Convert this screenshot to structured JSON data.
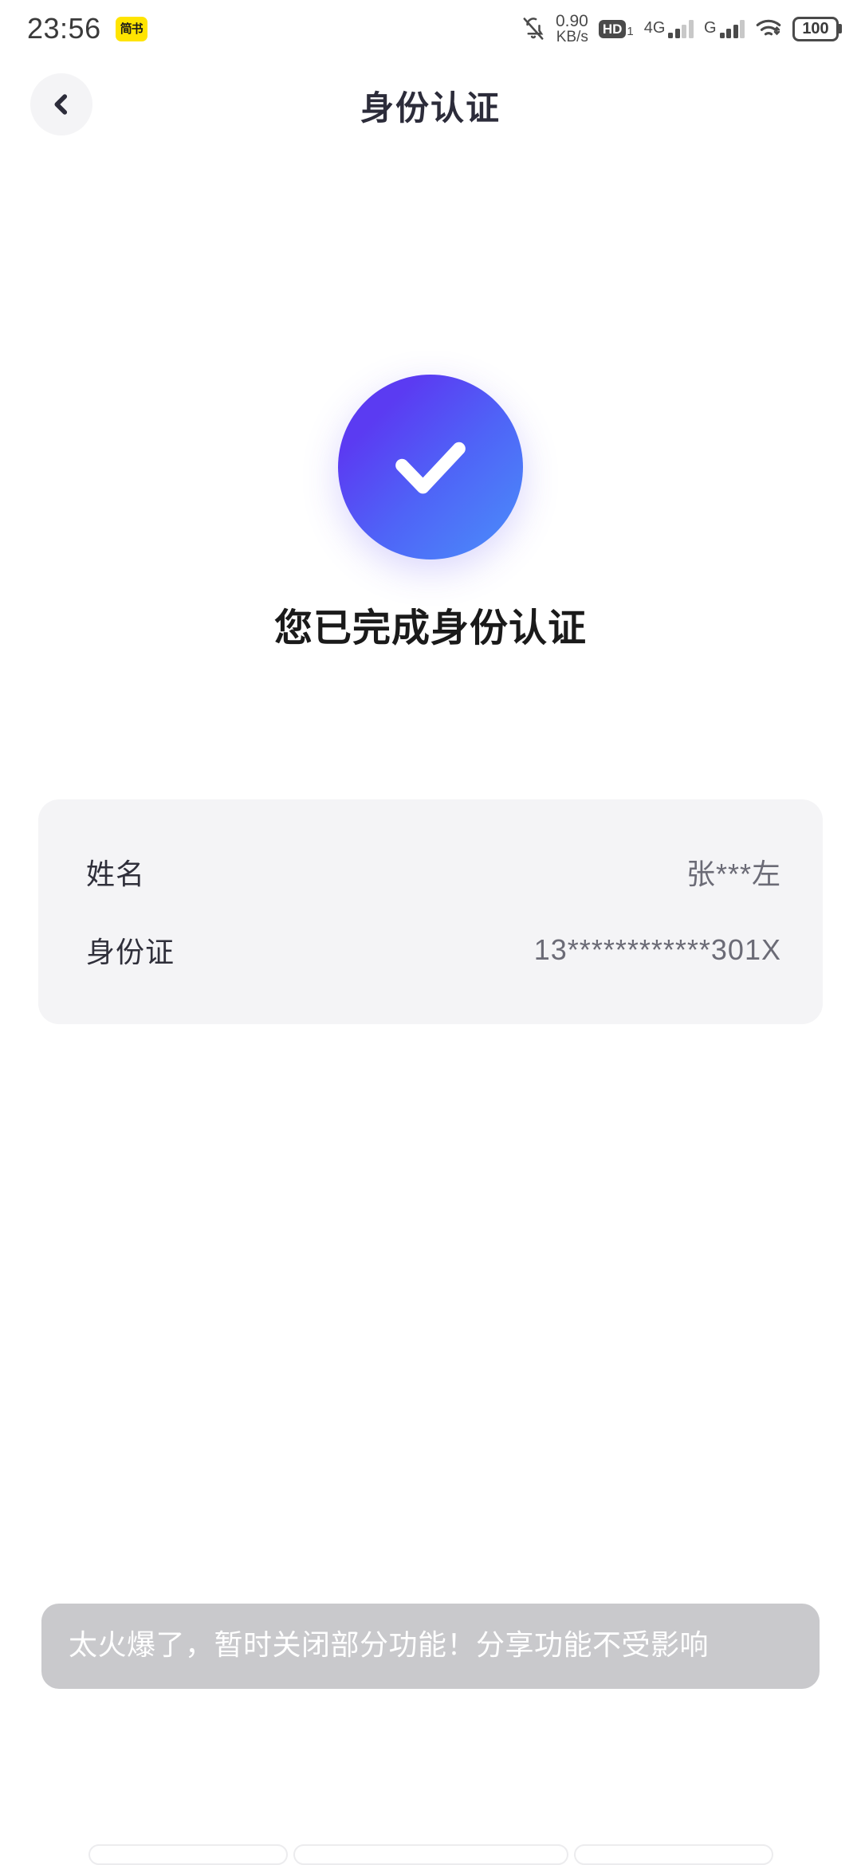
{
  "status_bar": {
    "time": "23:56",
    "app_badge_label": "简书",
    "mute_icon": "bell-slash-icon",
    "network_speed_value": "0.90",
    "network_speed_unit": "KB/s",
    "hd_label": "HD",
    "hd_sim_index": "1",
    "sim1_network": "4G",
    "sim2_network": "G",
    "wifi_icon": "wifi-icon",
    "battery_level": "100"
  },
  "header": {
    "title": "身份认证",
    "back_icon": "chevron-left-icon"
  },
  "main": {
    "success_icon": "check-circle-icon",
    "success_message": "您已完成身份认证",
    "info_rows": [
      {
        "label": "姓名",
        "value": "张***左"
      },
      {
        "label": "身份证",
        "value": "13************301X"
      }
    ]
  },
  "toast": {
    "message": "太火爆了，暂时关闭部分功能！分享功能不受影响"
  },
  "colors": {
    "accent_start": "#5B3BF2",
    "accent_end": "#4A90FA",
    "card_bg": "#F4F4F6",
    "toast_bg": "#C9C9CC",
    "title_text": "#2C2C3A",
    "value_text": "#6B6B76",
    "badge_yellow": "#FFE400"
  }
}
